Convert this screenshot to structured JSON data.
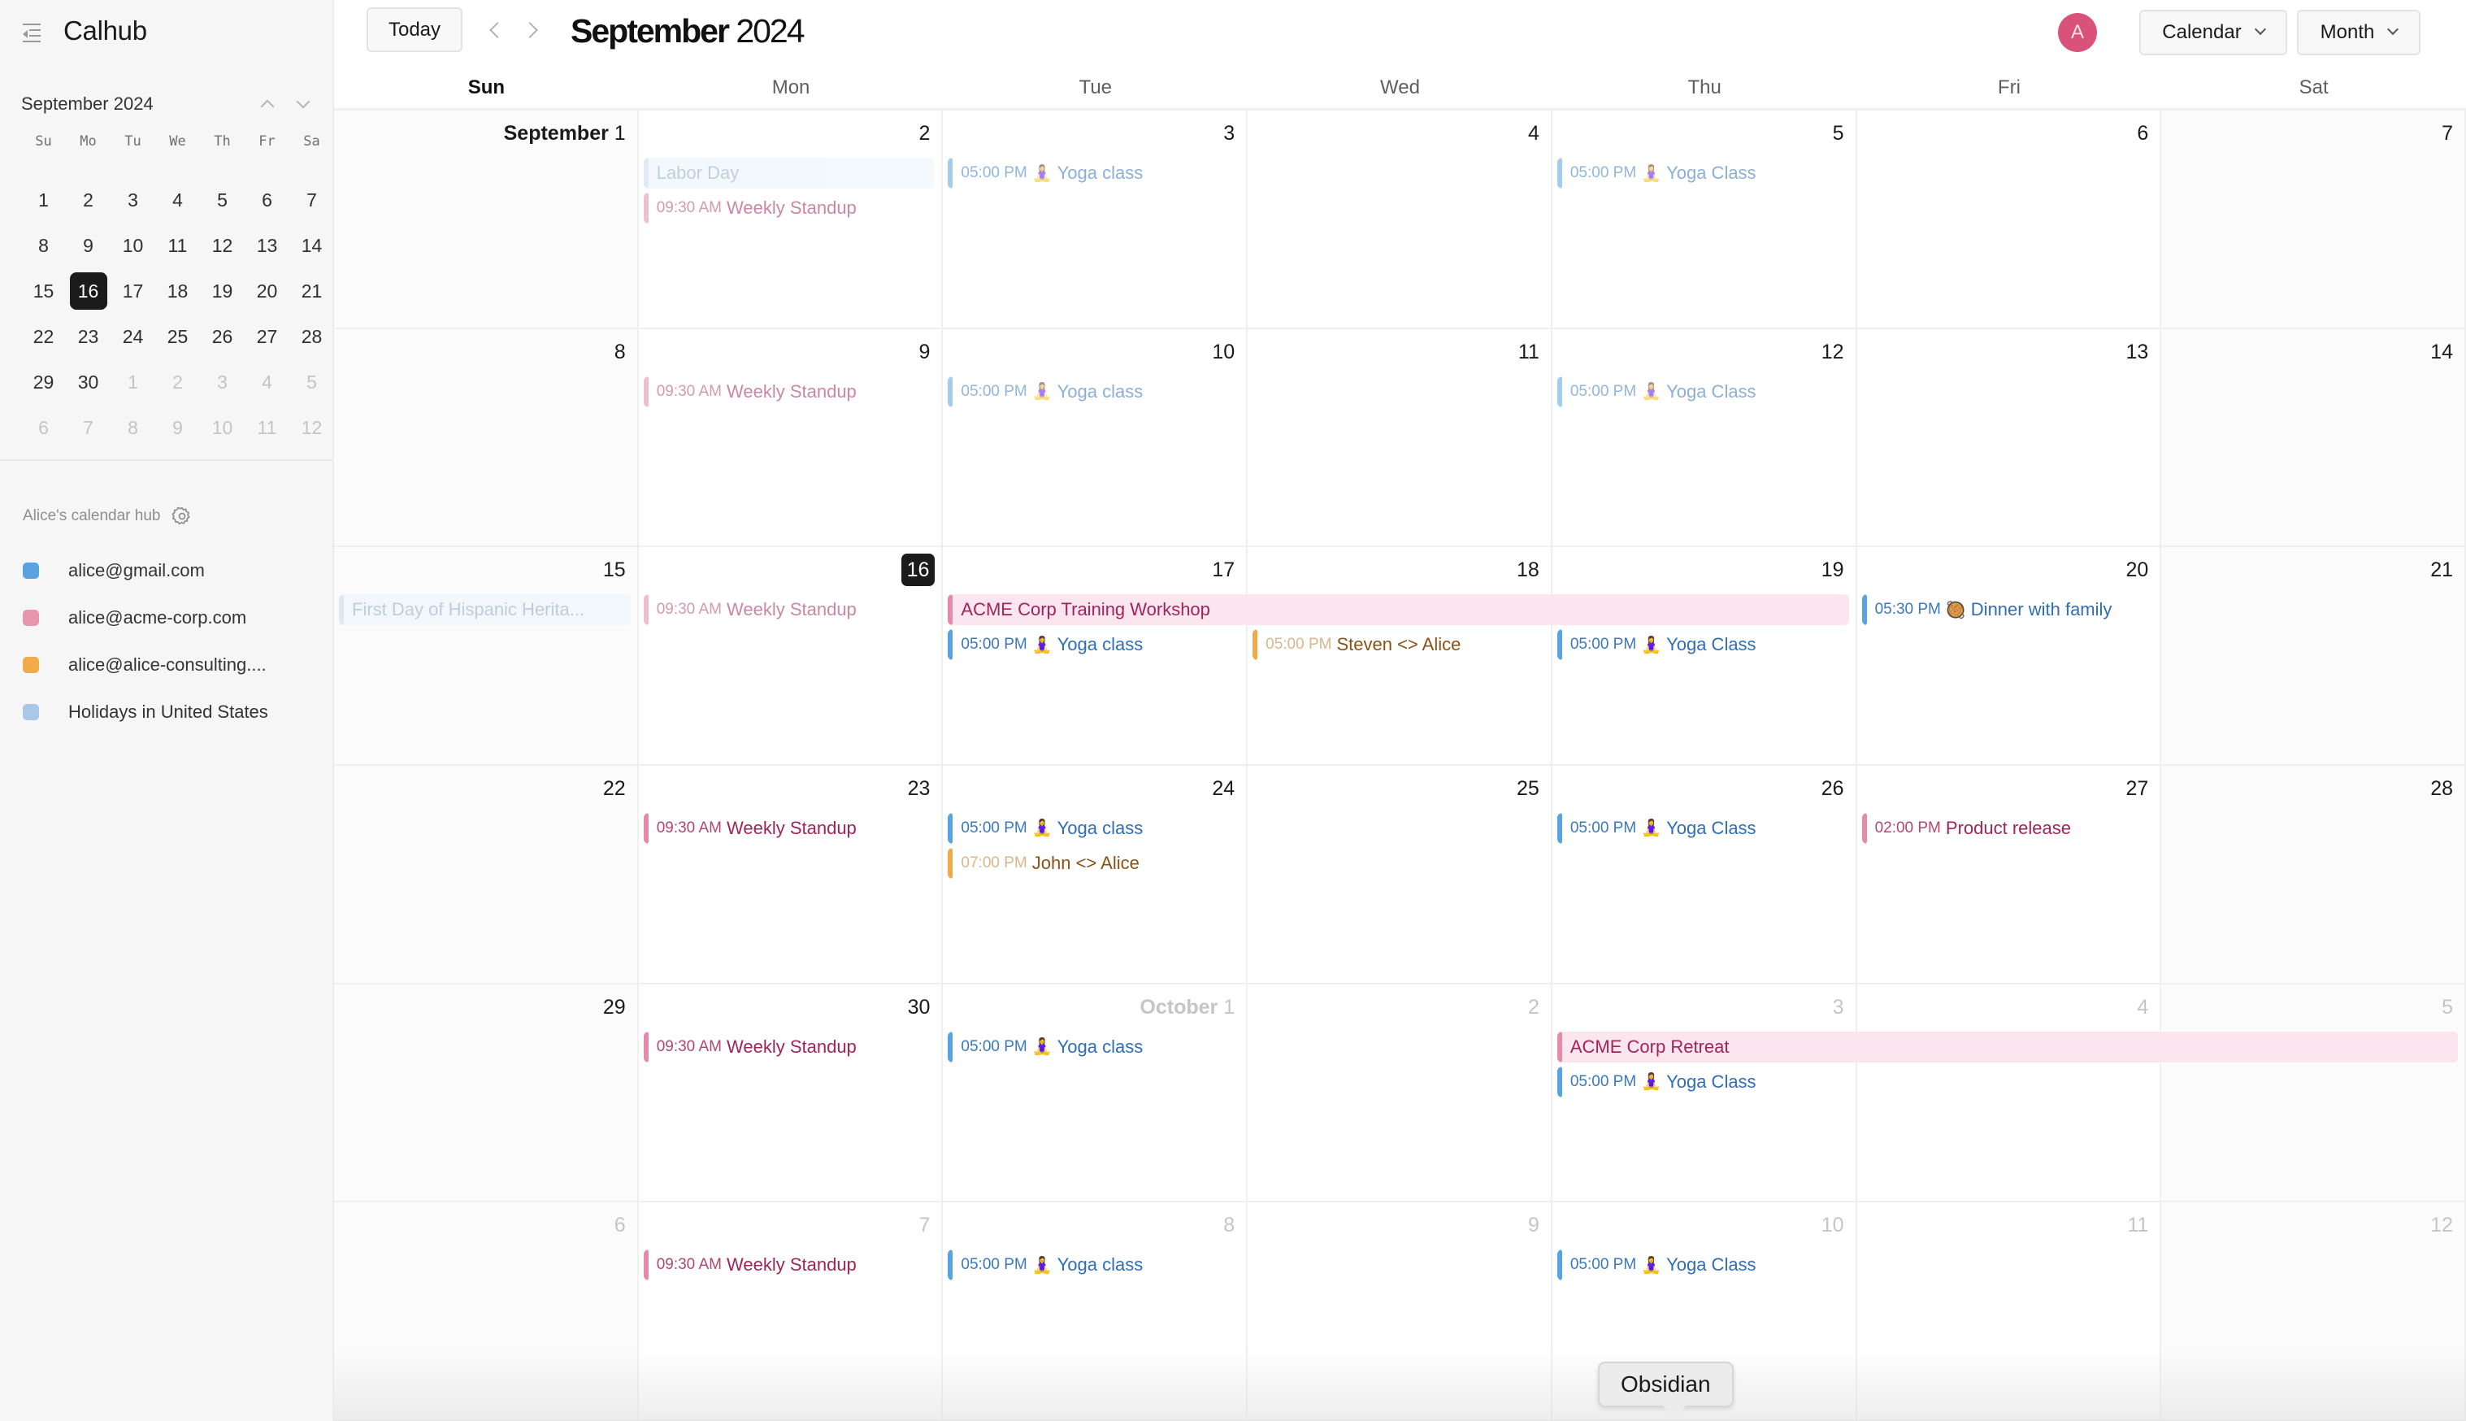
{
  "app": {
    "name": "Calhub"
  },
  "toolbar": {
    "today_label": "Today",
    "title_month": "September",
    "title_year": "2024",
    "avatar_initial": "A",
    "calendar_select": "Calendar",
    "view_select": "Month"
  },
  "mini_calendar": {
    "month_label": "September 2024",
    "weekdays": [
      "Su",
      "Mo",
      "Tu",
      "We",
      "Th",
      "Fr",
      "Sa"
    ],
    "days": [
      {
        "d": "1"
      },
      {
        "d": "2"
      },
      {
        "d": "3"
      },
      {
        "d": "4"
      },
      {
        "d": "5"
      },
      {
        "d": "6"
      },
      {
        "d": "7"
      },
      {
        "d": "8"
      },
      {
        "d": "9"
      },
      {
        "d": "10"
      },
      {
        "d": "11"
      },
      {
        "d": "12"
      },
      {
        "d": "13"
      },
      {
        "d": "14"
      },
      {
        "d": "15"
      },
      {
        "d": "16",
        "today": true
      },
      {
        "d": "17"
      },
      {
        "d": "18"
      },
      {
        "d": "19"
      },
      {
        "d": "20"
      },
      {
        "d": "21"
      },
      {
        "d": "22"
      },
      {
        "d": "23"
      },
      {
        "d": "24"
      },
      {
        "d": "25"
      },
      {
        "d": "26"
      },
      {
        "d": "27"
      },
      {
        "d": "28"
      },
      {
        "d": "29"
      },
      {
        "d": "30"
      },
      {
        "d": "1",
        "other": true
      },
      {
        "d": "2",
        "other": true
      },
      {
        "d": "3",
        "other": true
      },
      {
        "d": "4",
        "other": true
      },
      {
        "d": "5",
        "other": true
      },
      {
        "d": "6",
        "other": true
      },
      {
        "d": "7",
        "other": true
      },
      {
        "d": "8",
        "other": true
      },
      {
        "d": "9",
        "other": true
      },
      {
        "d": "10",
        "other": true
      },
      {
        "d": "11",
        "other": true
      },
      {
        "d": "12",
        "other": true
      }
    ]
  },
  "hub": {
    "label": "Alice's calendar hub",
    "calendars": [
      {
        "name": "alice@gmail.com",
        "color": "#5ba3e0"
      },
      {
        "name": "alice@acme-corp.com",
        "color": "#e896b0"
      },
      {
        "name": "alice@alice-consulting....",
        "color": "#f0ab48"
      },
      {
        "name": "Holidays in United States",
        "color": "#a9c7e8"
      }
    ]
  },
  "colors": {
    "gmail": {
      "bar": "#5ba3e0",
      "text": "#2f6db5",
      "time": "#3a79bd",
      "bg": "transparent"
    },
    "acme": {
      "bar": "#e68aa8",
      "text": "#a0245a",
      "time": "#b0476f",
      "bg": "transparent"
    },
    "acme_allday": {
      "bar": "#e68aa8",
      "text": "#a0245a",
      "time": "#b0476f",
      "bg": "#fbe6ef"
    },
    "consulting": {
      "bar": "#f0ab48",
      "text": "#8a5215",
      "time": "#d8b78c",
      "bg": "transparent"
    },
    "holiday": {
      "bar": "#c8d9ec",
      "text": "#8fa7c2",
      "time": "#8fa7c2",
      "bg": "#ebf4fd"
    }
  },
  "weekdays": [
    "Sun",
    "Mon",
    "Tue",
    "Wed",
    "Thu",
    "Fri",
    "Sat"
  ],
  "weeks": [
    {
      "days": [
        {
          "label": "September 1",
          "month_prefix": "September",
          "num": "1"
        },
        {
          "num": "2"
        },
        {
          "num": "3"
        },
        {
          "num": "4"
        },
        {
          "num": "5"
        },
        {
          "num": "6"
        },
        {
          "num": "7"
        }
      ],
      "events": [
        {
          "title": "Labor Day",
          "cal": "holiday",
          "start": 1,
          "span": 1,
          "row": 0,
          "allday": true,
          "faded": true
        },
        {
          "time": "09:30 AM",
          "title": "Weekly Standup",
          "cal": "acme",
          "start": 1,
          "span": 1,
          "row": 1,
          "faded": true
        },
        {
          "time": "05:00 PM",
          "emoji": "🧘‍♀️",
          "title": "Yoga class",
          "cal": "gmail",
          "start": 2,
          "span": 1,
          "row": 0,
          "faded": true
        },
        {
          "time": "05:00 PM",
          "emoji": "🧘‍♀️",
          "title": "Yoga Class",
          "cal": "gmail",
          "start": 4,
          "span": 1,
          "row": 0,
          "faded": true
        }
      ]
    },
    {
      "days": [
        {
          "num": "8"
        },
        {
          "num": "9"
        },
        {
          "num": "10"
        },
        {
          "num": "11"
        },
        {
          "num": "12"
        },
        {
          "num": "13"
        },
        {
          "num": "14"
        }
      ],
      "events": [
        {
          "time": "09:30 AM",
          "title": "Weekly Standup",
          "cal": "acme",
          "start": 1,
          "span": 1,
          "row": 0,
          "faded": true
        },
        {
          "time": "05:00 PM",
          "emoji": "🧘‍♀️",
          "title": "Yoga class",
          "cal": "gmail",
          "start": 2,
          "span": 1,
          "row": 0,
          "faded": true
        },
        {
          "time": "05:00 PM",
          "emoji": "🧘‍♀️",
          "title": "Yoga Class",
          "cal": "gmail",
          "start": 4,
          "span": 1,
          "row": 0,
          "faded": true
        }
      ]
    },
    {
      "days": [
        {
          "num": "15"
        },
        {
          "num": "16",
          "today": true
        },
        {
          "num": "17"
        },
        {
          "num": "18"
        },
        {
          "num": "19"
        },
        {
          "num": "20"
        },
        {
          "num": "21"
        }
      ],
      "events": [
        {
          "title": "First Day of Hispanic Herita...",
          "cal": "holiday",
          "start": 0,
          "span": 1,
          "row": 0,
          "allday": true,
          "faded": true
        },
        {
          "time": "09:30 AM",
          "title": "Weekly Standup",
          "cal": "acme",
          "start": 1,
          "span": 1,
          "row": 0,
          "faded": true
        },
        {
          "title": "ACME Corp Training Workshop",
          "cal": "acme_allday",
          "start": 2,
          "span": 3,
          "row": 0,
          "allday": true
        },
        {
          "time": "05:00 PM",
          "emoji": "🧘‍♀️",
          "title": "Yoga class",
          "cal": "gmail",
          "start": 2,
          "span": 1,
          "row": 1
        },
        {
          "time": "05:00 PM",
          "title": "Steven <> Alice",
          "cal": "consulting",
          "start": 3,
          "span": 1,
          "row": 1
        },
        {
          "time": "05:00 PM",
          "emoji": "🧘‍♀️",
          "title": "Yoga Class",
          "cal": "gmail",
          "start": 4,
          "span": 1,
          "row": 1
        },
        {
          "time": "05:30 PM",
          "emoji": "🥘",
          "title": "Dinner with family",
          "cal": "gmail",
          "start": 5,
          "span": 1,
          "row": 0
        }
      ]
    },
    {
      "days": [
        {
          "num": "22"
        },
        {
          "num": "23"
        },
        {
          "num": "24"
        },
        {
          "num": "25"
        },
        {
          "num": "26"
        },
        {
          "num": "27"
        },
        {
          "num": "28"
        }
      ],
      "events": [
        {
          "time": "09:30 AM",
          "title": "Weekly Standup",
          "cal": "acme",
          "start": 1,
          "span": 1,
          "row": 0
        },
        {
          "time": "05:00 PM",
          "emoji": "🧘‍♀️",
          "title": "Yoga class",
          "cal": "gmail",
          "start": 2,
          "span": 1,
          "row": 0
        },
        {
          "time": "07:00 PM",
          "title": "John <> Alice",
          "cal": "consulting",
          "start": 2,
          "span": 1,
          "row": 1
        },
        {
          "time": "05:00 PM",
          "emoji": "🧘‍♀️",
          "title": "Yoga Class",
          "cal": "gmail",
          "start": 4,
          "span": 1,
          "row": 0
        },
        {
          "time": "02:00 PM",
          "title": "Product release",
          "cal": "acme",
          "start": 5,
          "span": 1,
          "row": 0
        }
      ]
    },
    {
      "days": [
        {
          "num": "29"
        },
        {
          "num": "30"
        },
        {
          "label": "October 1",
          "month_prefix": "October",
          "num": "1",
          "other": true
        },
        {
          "num": "2",
          "other": true
        },
        {
          "num": "3",
          "other": true
        },
        {
          "num": "4",
          "other": true
        },
        {
          "num": "5",
          "other": true
        }
      ],
      "events": [
        {
          "time": "09:30 AM",
          "title": "Weekly Standup",
          "cal": "acme",
          "start": 1,
          "span": 1,
          "row": 0
        },
        {
          "time": "05:00 PM",
          "emoji": "🧘‍♀️",
          "title": "Yoga class",
          "cal": "gmail",
          "start": 2,
          "span": 1,
          "row": 0
        },
        {
          "title": "ACME Corp Retreat",
          "cal": "acme_allday",
          "start": 4,
          "span": 3,
          "row": 0,
          "allday": true
        },
        {
          "time": "05:00 PM",
          "emoji": "🧘‍♀️",
          "title": "Yoga Class",
          "cal": "gmail",
          "start": 4,
          "span": 1,
          "row": 1
        }
      ]
    },
    {
      "days": [
        {
          "num": "6",
          "other": true
        },
        {
          "num": "7",
          "other": true
        },
        {
          "num": "8",
          "other": true
        },
        {
          "num": "9",
          "other": true
        },
        {
          "num": "10",
          "other": true
        },
        {
          "num": "11",
          "other": true
        },
        {
          "num": "12",
          "other": true
        }
      ],
      "events": [
        {
          "time": "09:30 AM",
          "title": "Weekly Standup",
          "cal": "acme",
          "start": 1,
          "span": 1,
          "row": 0
        },
        {
          "time": "05:00 PM",
          "emoji": "🧘‍♀️",
          "title": "Yoga class",
          "cal": "gmail",
          "start": 2,
          "span": 1,
          "row": 0
        },
        {
          "time": "05:00 PM",
          "emoji": "🧘‍♀️",
          "title": "Yoga Class",
          "cal": "gmail",
          "start": 4,
          "span": 1,
          "row": 0
        }
      ]
    }
  ],
  "tooltip": {
    "text": "Obsidian"
  }
}
